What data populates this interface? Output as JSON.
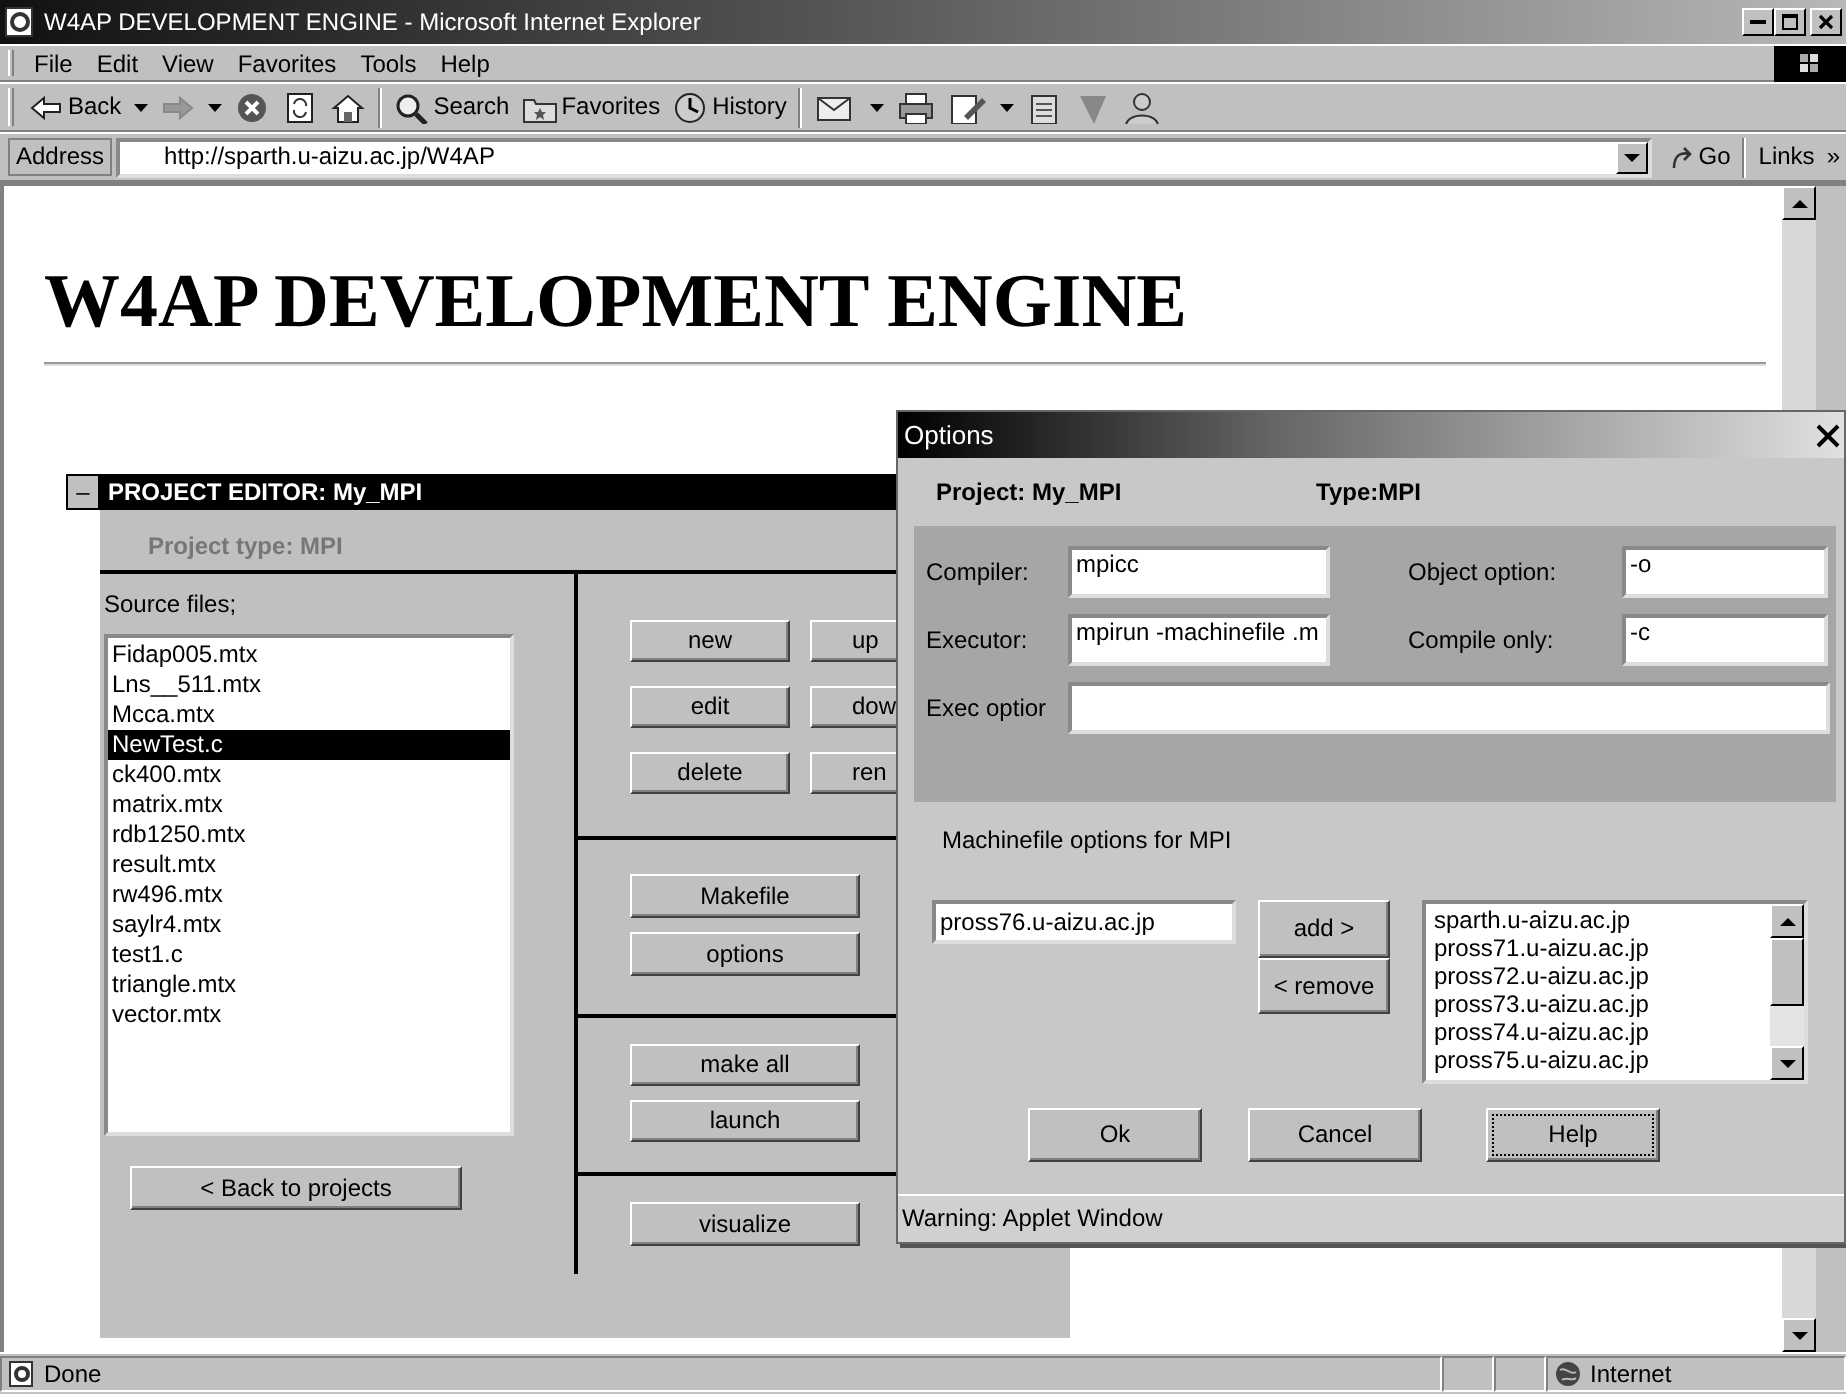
{
  "window": {
    "title": "W4AP DEVELOPMENT ENGINE - Microsoft Internet Explorer"
  },
  "menu": [
    {
      "label": "File"
    },
    {
      "label": "Edit"
    },
    {
      "label": "View"
    },
    {
      "label": "Favorites"
    },
    {
      "label": "Tools"
    },
    {
      "label": "Help"
    }
  ],
  "toolbar": [
    [
      {
        "kind": "back",
        "label": "Back",
        "dropdown": true
      },
      {
        "kind": "forward",
        "dropdown": true
      },
      {
        "kind": "stop",
        "dropdown": false
      },
      {
        "kind": "refresh",
        "dropdown": false
      },
      {
        "kind": "home",
        "dropdown": false
      }
    ],
    [
      {
        "kind": "search",
        "label": "Search",
        "dropdown": false
      },
      {
        "kind": "favorites",
        "label": "Favorites",
        "dropdown": false
      },
      {
        "kind": "history",
        "label": "History",
        "dropdown": false
      }
    ],
    [
      {
        "kind": "mail",
        "dropdown": true
      },
      {
        "kind": "print",
        "dropdown": false
      },
      {
        "kind": "edit",
        "dropdown": true
      },
      {
        "kind": "discuss",
        "dropdown": false
      },
      {
        "kind": "filter",
        "dropdown": false
      },
      {
        "kind": "messenger",
        "dropdown": false
      }
    ]
  ],
  "address": {
    "label": "Address",
    "value": "http://sparth.u-aizu.ac.jp/W4AP",
    "go": "Go",
    "links": "Links",
    "more": "»"
  },
  "page": {
    "heading": "W4AP DEVELOPMENT ENGINE"
  },
  "project_editor": {
    "collapse": "–",
    "title": "PROJECT EDITOR: My_MPI",
    "project_type": "Project type: MPI",
    "source_label": "Source files;",
    "files": [
      {
        "name": "Fidap005.mtx",
        "selected": false
      },
      {
        "name": "Lns__511.mtx",
        "selected": false
      },
      {
        "name": "Mcca.mtx",
        "selected": false
      },
      {
        "name": "NewTest.c",
        "selected": true
      },
      {
        "name": "ck400.mtx",
        "selected": false
      },
      {
        "name": "matrix.mtx",
        "selected": false
      },
      {
        "name": "rdb1250.mtx",
        "selected": false
      },
      {
        "name": "result.mtx",
        "selected": false
      },
      {
        "name": "rw496.mtx",
        "selected": false
      },
      {
        "name": "saylr4.mtx",
        "selected": false
      },
      {
        "name": "test1.c",
        "selected": false
      },
      {
        "name": "triangle.mtx",
        "selected": false
      },
      {
        "name": "vector.mtx",
        "selected": false
      }
    ],
    "back_button": "< Back to projects",
    "sections": [
      [
        [
          "new",
          "up"
        ],
        [
          "edit",
          "dow"
        ],
        [
          "delete",
          "ren"
        ]
      ],
      [
        [
          "Makefile"
        ],
        [
          "options"
        ]
      ],
      [
        [
          "make all"
        ],
        [
          "launch"
        ]
      ],
      [
        [
          "visualize"
        ]
      ]
    ]
  },
  "dialog": {
    "title": "Options",
    "project": "Project: My_MPI",
    "type": "Type:MPI",
    "fields": [
      {
        "label": "Compiler:",
        "value": "mpicc"
      },
      {
        "label": "Object option:",
        "value": "-o"
      },
      {
        "label": "Executor:",
        "value": "mpirun -machinefile .m"
      },
      {
        "label": "Compile only:",
        "value": "-c"
      },
      {
        "label": "Exec optior"
      }
    ],
    "machinefile_label": "Machinefile options for MPI",
    "host_input": "pross76.u-aizu.ac.jp",
    "add": "add >",
    "remove": "< remove",
    "hosts": [
      "sparth.u-aizu.ac.jp",
      "pross71.u-aizu.ac.jp",
      "pross72.u-aizu.ac.jp",
      "pross73.u-aizu.ac.jp",
      "pross74.u-aizu.ac.jp",
      "pross75.u-aizu.ac.jp"
    ],
    "buttons": [
      {
        "label": "Ok",
        "focused": false
      },
      {
        "label": "Cancel",
        "focused": false
      },
      {
        "label": "Help",
        "focused": true
      }
    ],
    "warning": "Warning: Applet Window"
  },
  "status_bar": {
    "text": "Done",
    "zone": "Internet"
  }
}
